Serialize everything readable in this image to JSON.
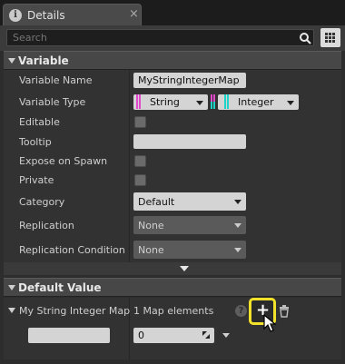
{
  "tab": {
    "title": "Details",
    "close": "×"
  },
  "search": {
    "placeholder": "Search"
  },
  "sections": {
    "variable": "Variable",
    "default_value": "Default Value"
  },
  "variable": {
    "name_label": "Variable Name",
    "name_value": "MyStringIntegerMap",
    "type_label": "Variable Type",
    "key_type": "String",
    "value_type": "Integer",
    "editable_label": "Editable",
    "tooltip_label": "Tooltip",
    "expose_label": "Expose on Spawn",
    "private_label": "Private",
    "category_label": "Category",
    "category_value": "Default",
    "replication_label": "Replication",
    "replication_value": "None",
    "replication_condition_label": "Replication Condition",
    "replication_condition_value": "None"
  },
  "default_value": {
    "map_label": "My String Integer Map",
    "map_count": "1 Map elements",
    "help_icon": "?",
    "element_value": "0"
  },
  "colors": {
    "string_pin": "#e24acb",
    "integer_pin": "#1fd3c8",
    "highlight": "#f2e22a"
  }
}
